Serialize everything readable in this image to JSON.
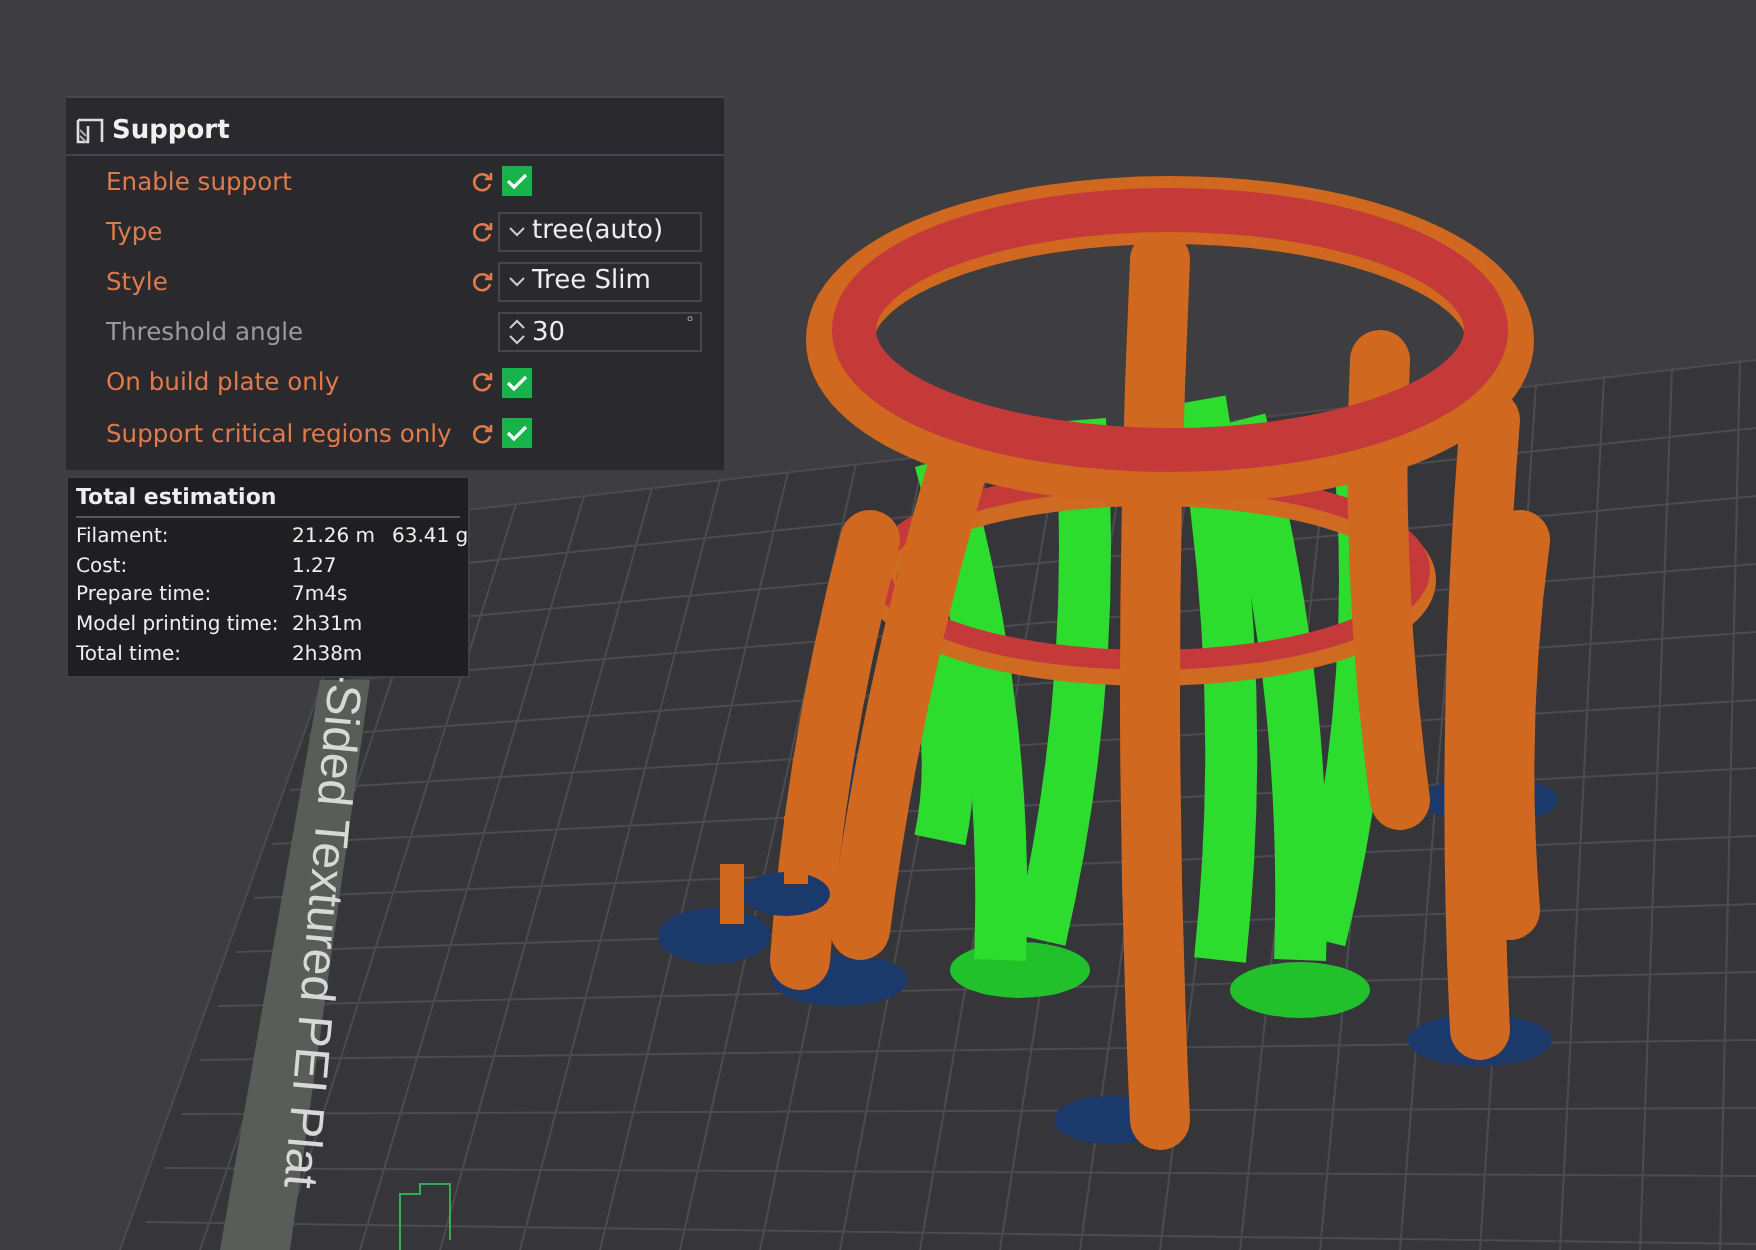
{
  "support_panel": {
    "title": "Support",
    "options": [
      {
        "kind": "checkbox",
        "label": "Enable support",
        "modified": true,
        "checked": true
      },
      {
        "kind": "dropdown",
        "label": "Type",
        "modified": true,
        "value": "tree(auto)"
      },
      {
        "kind": "dropdown",
        "label": "Style",
        "modified": true,
        "value": "Tree Slim"
      },
      {
        "kind": "spinner",
        "label": "Threshold angle",
        "modified": false,
        "value": "30",
        "unit": "°"
      },
      {
        "kind": "checkbox",
        "label": "On build plate only",
        "modified": true,
        "checked": true
      },
      {
        "kind": "checkbox",
        "label": "Support critical regions only",
        "modified": true,
        "checked": true
      }
    ]
  },
  "estimation": {
    "title": "Total estimation",
    "rows": [
      {
        "label": "Filament:",
        "value": "21.26 m",
        "extra": "63.41 g"
      },
      {
        "label": "Cost:",
        "value": "1.27"
      },
      {
        "label": "Prepare time:",
        "value": "7m4s"
      },
      {
        "label": "Model printing time:",
        "value": "2h31m"
      },
      {
        "label": "Total time:",
        "value": "2h38m"
      }
    ]
  },
  "plate_label": "-Sided Textured PEI Plat"
}
